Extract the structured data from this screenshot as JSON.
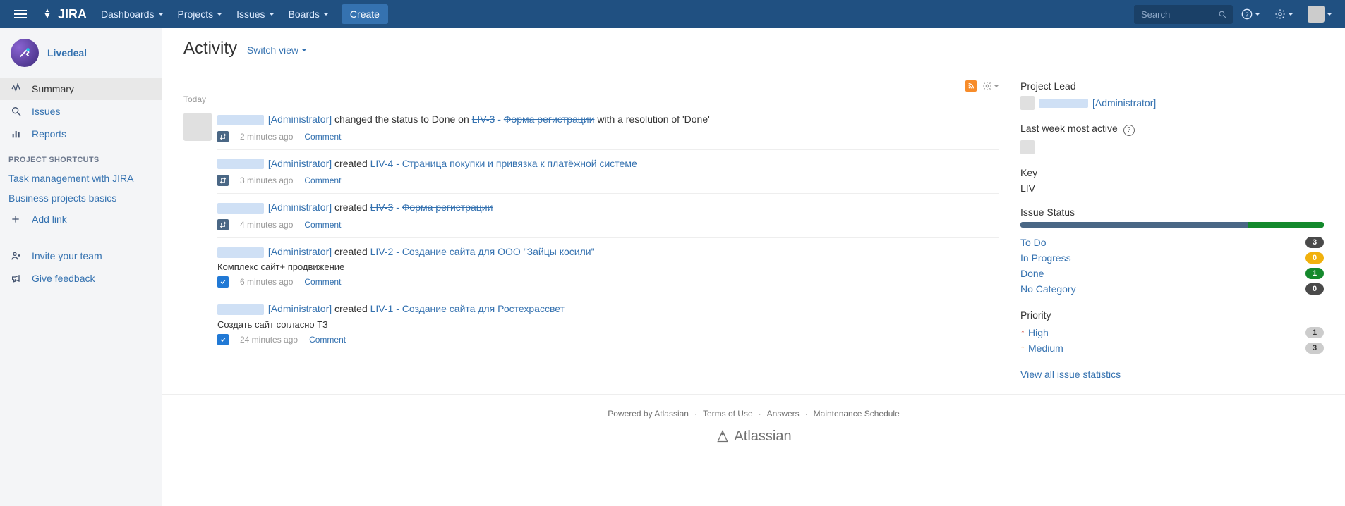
{
  "nav": {
    "dashboards": "Dashboards",
    "projects": "Projects",
    "issues": "Issues",
    "boards": "Boards",
    "create": "Create",
    "search_placeholder": "Search"
  },
  "project": {
    "name": "Livedeal"
  },
  "sidebar": {
    "summary": "Summary",
    "issues": "Issues",
    "reports": "Reports",
    "shortcuts_title": "PROJECT SHORTCUTS",
    "shortcut1": "Task management with JIRA",
    "shortcut2": "Business projects basics",
    "add_link": "Add link",
    "invite": "Invite your team",
    "feedback": "Give feedback"
  },
  "page": {
    "title": "Activity",
    "switch_view": "Switch view"
  },
  "activity": {
    "group": "Today",
    "comment_label": "Comment",
    "items": [
      {
        "role": "[Administrator]",
        "verb1": " changed the status to Done on ",
        "issue_key": "LIV-3",
        "issue_sep": " - ",
        "issue_title": "Форма регистрации",
        "strike": true,
        "verb2": " with a resolution of 'Done'",
        "body": "",
        "time": "2 minutes ago",
        "icon": "change"
      },
      {
        "role": "[Administrator]",
        "verb1": " created ",
        "issue_key": "LIV-4",
        "issue_sep": " - ",
        "issue_title": "Страница покупки и привязка к платёжной системе",
        "strike": false,
        "verb2": "",
        "body": "",
        "time": "3 minutes ago",
        "icon": "change"
      },
      {
        "role": "[Administrator]",
        "verb1": " created ",
        "issue_key": "LIV-3",
        "issue_sep": " - ",
        "issue_title": "Форма регистрации",
        "strike": true,
        "verb2": "",
        "body": "",
        "time": "4 minutes ago",
        "icon": "change"
      },
      {
        "role": "[Administrator]",
        "verb1": " created ",
        "issue_key": "LIV-2",
        "issue_sep": " - ",
        "issue_title": "Создание сайта для ООО \"Зайцы косили\"",
        "strike": false,
        "verb2": "",
        "body": "Комплекс сайт+ продвижение",
        "time": "6 minutes ago",
        "icon": "check"
      },
      {
        "role": "[Administrator]",
        "verb1": " created ",
        "issue_key": "LIV-1",
        "issue_sep": " - ",
        "issue_title": "Создание сайта для Ростехрассвет",
        "strike": false,
        "verb2": "",
        "body": "Создать сайт согласно ТЗ",
        "time": "24 minutes ago",
        "icon": "check"
      }
    ]
  },
  "side": {
    "lead_label": "Project Lead",
    "lead_name": "[Administrator]",
    "active_label": "Last week most active",
    "key_label": "Key",
    "key_value": "LIV",
    "status_label": "Issue Status",
    "status_bar": {
      "todo_pct": 75,
      "done_pct": 25
    },
    "statuses": [
      {
        "label": "To Do",
        "count": "3",
        "badge": "dark"
      },
      {
        "label": "In Progress",
        "count": "0",
        "badge": "yellow"
      },
      {
        "label": "Done",
        "count": "1",
        "badge": "green"
      },
      {
        "label": "No Category",
        "count": "0",
        "badge": "dark"
      }
    ],
    "priority_label": "Priority",
    "priorities": [
      {
        "label": "High",
        "count": "1",
        "arrow": "red"
      },
      {
        "label": "Medium",
        "count": "3",
        "arrow": "orange"
      }
    ],
    "view_all": "View all issue statistics"
  },
  "footer": {
    "powered_prefix": "Powered by ",
    "atlassian": "Atlassian",
    "terms": "Terms of Use",
    "answers": "Answers",
    "maintenance": "Maintenance Schedule",
    "brand": "Atlassian"
  }
}
